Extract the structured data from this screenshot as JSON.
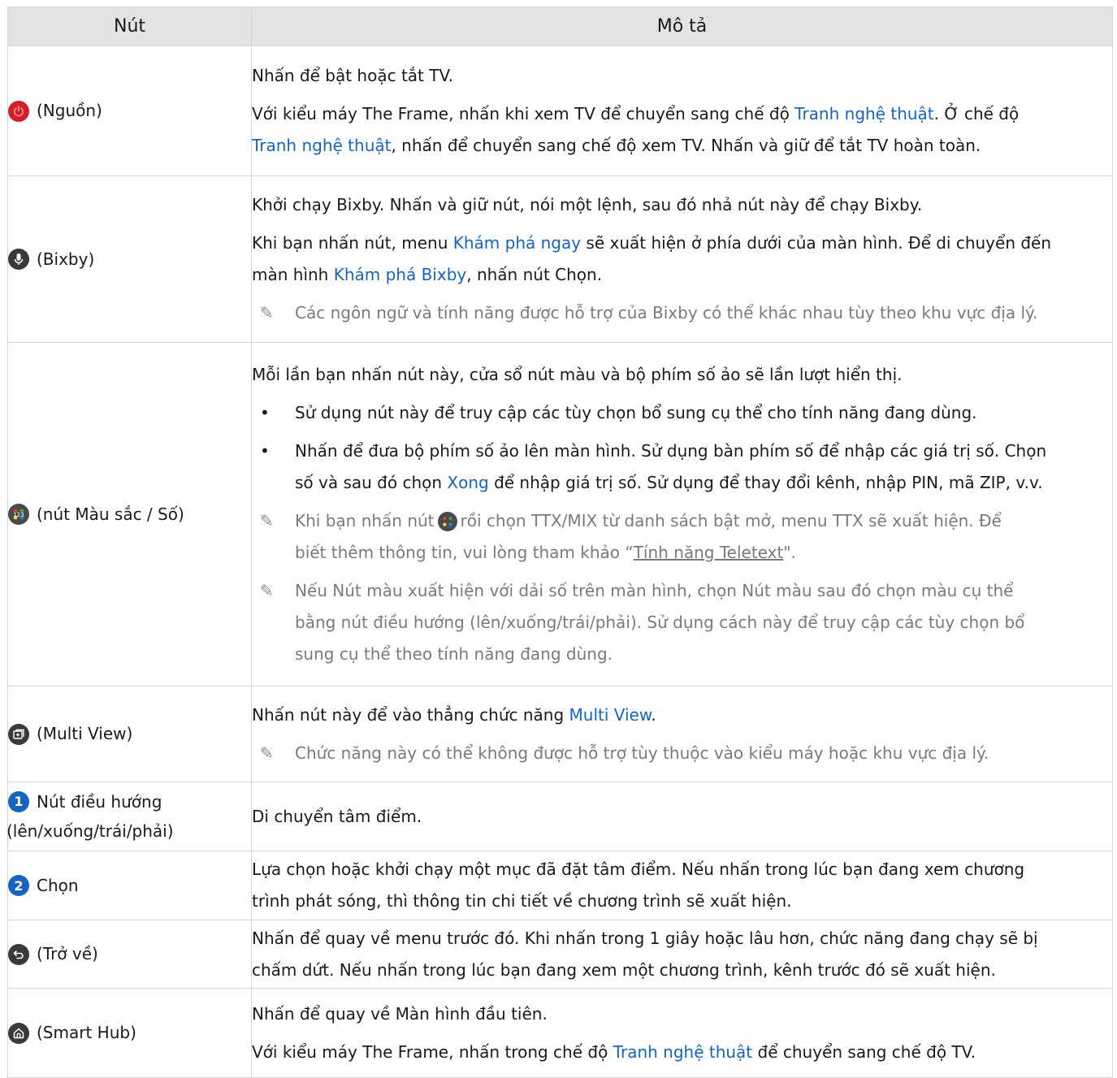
{
  "header": {
    "col_button": "Nút",
    "col_description": "Mô tả"
  },
  "rows": [
    {
      "button": "(Nguồn)",
      "icon": "power-icon",
      "p1": "Nhấn để bật hoặc tắt TV.",
      "p2a": "Với kiểu máy The Frame, nhấn khi xem TV để chuyển sang chế độ ",
      "p2link1": "Tranh nghệ thuật",
      "p2b": ". Ở chế độ",
      "p2link2": "Tranh nghệ thuật",
      "p2c": ", nhấn để chuyển sang chế độ xem TV. Nhấn và giữ để tắt TV hoàn toàn."
    },
    {
      "button": "(Bixby)",
      "icon": "microphone-icon",
      "p1": "Khởi chạy Bixby. Nhấn và giữ nút, nói một lệnh, sau đó nhả nút này để chạy Bixby.",
      "p2a": "Khi bạn nhấn nút, menu ",
      "p2link1": "Khám phá ngay",
      "p2b": " sẽ xuất hiện ở phía dưới của màn hình. Để di chuyển đến",
      "p2c": "màn hình ",
      "p2link2": "Khám phá Bixby",
      "p2d": ", nhấn nút Chọn.",
      "note": "Các ngôn ngữ và tính năng được hỗ trợ của Bixby có thể khác nhau tùy theo khu vực địa lý."
    },
    {
      "button": "(nút Màu sắc / Số)",
      "icon": "color-number-icon",
      "p1": "Mỗi lần bạn nhấn nút này, cửa sổ nút màu và bộ phím số ảo sẽ lần lượt hiển thị.",
      "b1": "Sử dụng nút này để truy cập các tùy chọn bổ sung cụ thể cho tính năng đang dùng.",
      "b2a": "Nhấn để đưa bộ phím số ảo lên màn hình. Sử dụng bàn phím số để nhập các giá trị số. Chọn",
      "b2b": "số và sau đó chọn ",
      "b2link": "Xong",
      "b2c": " để nhập giá trị số. Sử dụng để thay đổi kênh, nhập PIN, mã ZIP, v.v.",
      "n1a": "Khi bạn nhấn nút",
      "n1b": "rồi chọn TTX/MIX từ danh sách bật mở, menu TTX sẽ xuất hiện. Để",
      "n1c": "biết thêm thông tin, vui lòng tham khảo “",
      "n1link": "Tính năng Teletext",
      "n1d": "\".",
      "n2a": "Nếu Nút màu xuất hiện với dải số trên màn hình, chọn Nút màu sau đó chọn màu cụ thể",
      "n2b": "bằng nút điều hướng (lên/xuống/trái/phải). Sử dụng cách này để truy cập các tùy chọn bổ",
      "n2c": "sung cụ thể theo tính năng đang dùng."
    },
    {
      "button": "(Multi View)",
      "icon": "multi-view-icon",
      "p1a": "Nhấn nút này để vào thẳng chức năng ",
      "p1link": "Multi View",
      "p1b": ".",
      "note": "Chức năng này có thể không được hỗ trợ tùy thuộc vào kiểu máy hoặc khu vực địa lý."
    },
    {
      "num": "1",
      "button1": "Nút điều hướng",
      "button2": "(lên/xuống/trái/phải)",
      "p1": "Di chuyển tâm điểm."
    },
    {
      "num": "2",
      "button": "Chọn",
      "p1": "Lựa chọn hoặc khởi chạy một mục đã đặt tâm điểm. Nếu nhấn trong lúc bạn đang xem chương",
      "p2": "trình phát sóng, thì thông tin chi tiết về chương trình sẽ xuất hiện."
    },
    {
      "button": "(Trở về)",
      "icon": "return-icon",
      "p1": "Nhấn để quay về menu trước đó. Khi nhấn trong 1 giây hoặc lâu hơn, chức năng đang chạy sẽ bị",
      "p2": "chấm dứt. Nếu nhấn trong lúc bạn đang xem một chương trình, kênh trước đó sẽ xuất hiện."
    },
    {
      "button": "(Smart Hub)",
      "icon": "home-icon",
      "p1": "Nhấn để quay về Màn hình đầu tiên.",
      "p2a": "Với kiểu máy The Frame, nhấn trong chế độ ",
      "p2link": "Tranh nghệ thuật",
      "p2b": " để chuyển sang chế độ TV."
    }
  ]
}
